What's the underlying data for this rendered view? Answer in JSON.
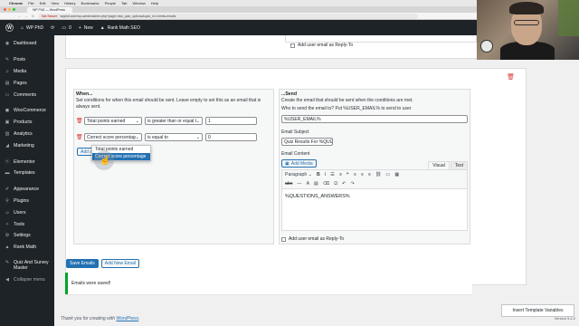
{
  "macos": {
    "app": "Chrome",
    "menus": [
      "File",
      "Edit",
      "View",
      "History",
      "Bookmarks",
      "People",
      "Tab",
      "Window",
      "Help"
    ]
  },
  "browser": {
    "tab_title": "WP PhD — WordPress",
    "not_secure": "Not Secure",
    "url": "wpphd.com/wp-admin/admin.php?page=mlw_quiz_options&quiz_id=1#mlw-emails"
  },
  "adminbar": {
    "site": "WP PhD",
    "comments_count": "0",
    "new_label": "New",
    "seo_label": "Rank Math SEO"
  },
  "sidebar": {
    "items": [
      {
        "label": "Dashboard",
        "icon": "dashboard-icon"
      },
      {
        "label": "Posts",
        "icon": "pin-icon"
      },
      {
        "label": "Media",
        "icon": "media-icon"
      },
      {
        "label": "Pages",
        "icon": "pages-icon"
      },
      {
        "label": "Comments",
        "icon": "comment-icon"
      },
      {
        "label": "WooCommerce",
        "icon": "woo-icon"
      },
      {
        "label": "Products",
        "icon": "archive-icon"
      },
      {
        "label": "Analytics",
        "icon": "chart-icon"
      },
      {
        "label": "Marketing",
        "icon": "megaphone-icon"
      },
      {
        "label": "Elementor",
        "icon": "elementor-icon"
      },
      {
        "label": "Templates",
        "icon": "folder-icon"
      },
      {
        "label": "Appearance",
        "icon": "brush-icon"
      },
      {
        "label": "Plugins",
        "icon": "plug-icon"
      },
      {
        "label": "Users",
        "icon": "user-icon"
      },
      {
        "label": "Tools",
        "icon": "wrench-icon"
      },
      {
        "label": "Settings",
        "icon": "settings-icon"
      },
      {
        "label": "Rank Math",
        "icon": "rankmath-icon"
      },
      {
        "label": "Quiz And Survey Master",
        "icon": "quiz-icon"
      },
      {
        "label": "Collapse menu",
        "icon": "collapse-icon"
      }
    ]
  },
  "email_top": {
    "reply_to_label": "Add user email as Reply-To"
  },
  "email": {
    "when_heading": "When...",
    "when_desc": "Set conditions for when this email should be sent. Leave empty to set this as an email that is always sent.",
    "conditions": [
      {
        "field": "Total points earned",
        "operator": "is greater than or equal to",
        "value": "1"
      },
      {
        "field": "Correct score percentage",
        "operator": "is equal to",
        "value": "0"
      }
    ],
    "dropdown_options": [
      "Total points earned",
      "Correct score percentage"
    ],
    "add_condition_label": "Add additional condition",
    "send_heading": "...Send",
    "send_desc": "Create the email that should be sent when the conditions are met.",
    "to_label": "Who to send the email to? Put %USER_EMAIL% to send to user",
    "to_value": "%USER_EMAIL%",
    "subject_label": "Email Subject",
    "subject_value": "Quiz Results For %QUIZ",
    "content_label": "Email Content",
    "add_media_label": "Add Media",
    "tab_visual": "Visual",
    "tab_text": "Text",
    "paragraph_label": "Paragraph",
    "content_value": "%QUESTIONS_ANSWERS%",
    "reply_to_label": "Add user email as Reply-To"
  },
  "actions": {
    "save_label": "Save Emails",
    "add_label": "Add New Email"
  },
  "notice": {
    "text": "Emails were saved!"
  },
  "footer": {
    "text": "Thank you for creating with",
    "link": "WordPress",
    "version": "Version 5.4.2"
  },
  "template_vars_label": "Insert Template Variables",
  "colors": {
    "admin_dark": "#1d2327",
    "wp_blue": "#2271b1",
    "delete_red": "#d63638",
    "success_green": "#00a32a"
  }
}
